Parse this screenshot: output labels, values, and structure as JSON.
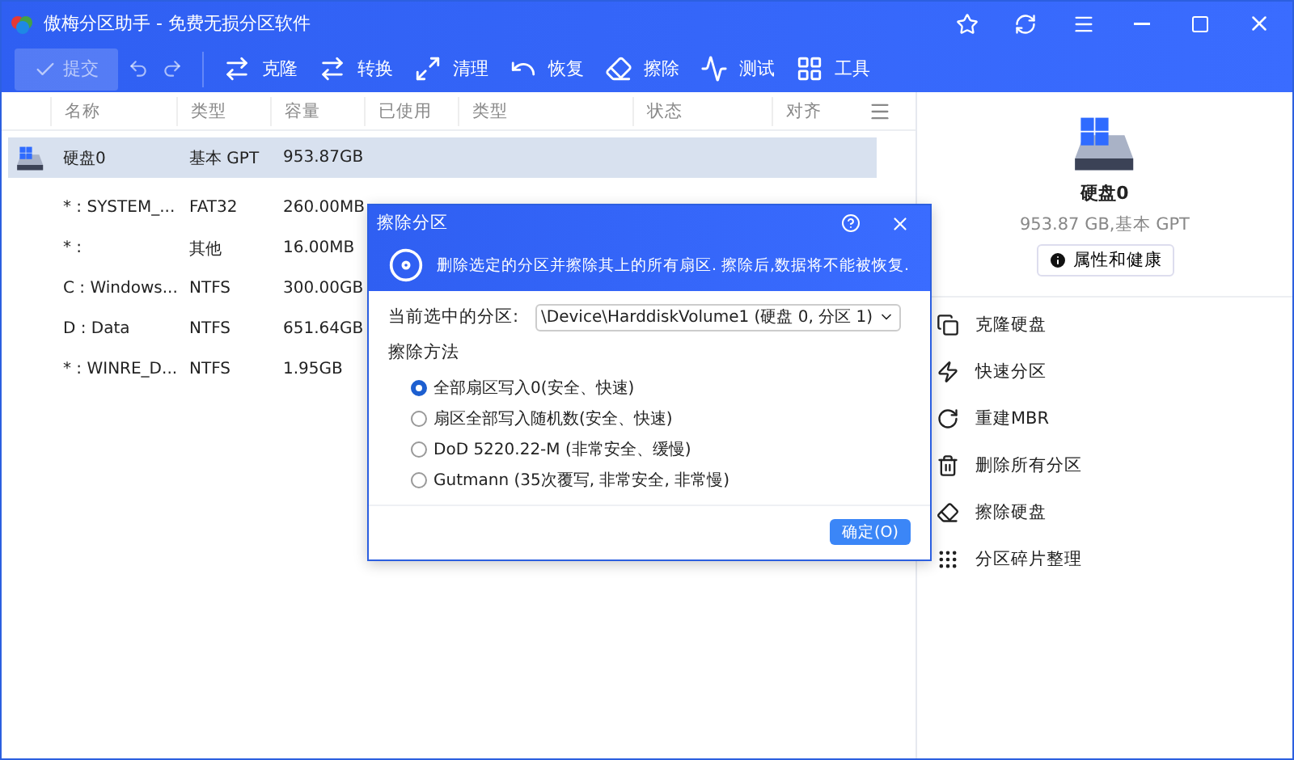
{
  "window": {
    "title": "傲梅分区助手 - 免费无损分区软件"
  },
  "toolbar": {
    "commit": {
      "label": "提交",
      "disabled": true
    },
    "tools": [
      {
        "kind": "clone",
        "label": "克隆"
      },
      {
        "kind": "convert",
        "label": "转换"
      },
      {
        "kind": "clean",
        "label": "清理"
      },
      {
        "kind": "recover",
        "label": "恢复"
      },
      {
        "kind": "wipe",
        "label": "擦除"
      },
      {
        "kind": "test",
        "label": "测试"
      },
      {
        "kind": "tools",
        "label": "工具"
      }
    ]
  },
  "table": {
    "columns": [
      "名称",
      "类型",
      "容量",
      "已使用",
      "类型",
      "状态",
      "对齐"
    ],
    "disks": [
      {
        "name": "硬盘0",
        "type": "基本 GPT",
        "capacity": "953.87GB",
        "selected": true,
        "children": [
          {
            "name": "* : SYSTEM_...",
            "fs": "FAT32",
            "capacity": "260.00MB",
            "selected": false
          },
          {
            "name": "* :",
            "fs": "其他",
            "capacity": "16.00MB",
            "selected": false
          },
          {
            "name": "C : Windows...",
            "fs": "NTFS",
            "capacity": "300.00GB",
            "selected": false
          },
          {
            "name": "D : Data",
            "fs": "NTFS",
            "capacity": "651.64GB",
            "selected": false
          },
          {
            "name": "* : WINRE_D...",
            "fs": "NTFS",
            "capacity": "1.95GB",
            "selected": false
          }
        ]
      }
    ]
  },
  "side_panel": {
    "disk_name": "硬盘0",
    "disk_summary": "953.87 GB,基本 GPT",
    "health_button": "属性和健康",
    "actions": [
      {
        "kind": "clone",
        "label": "克隆硬盘"
      },
      {
        "kind": "quick",
        "label": "快速分区"
      },
      {
        "kind": "mbr",
        "label": "重建MBR"
      },
      {
        "kind": "delete",
        "label": "删除所有分区"
      },
      {
        "kind": "erase",
        "label": "擦除硬盘"
      },
      {
        "kind": "defrag",
        "label": "分区碎片整理"
      }
    ]
  },
  "dialog": {
    "title": "擦除分区",
    "message": "删除选定的分区并擦除其上的所有扇区. 擦除后,数据将不能被恢复.",
    "partition_label": "当前选中的分区:",
    "partition_value": "\\Device\\HarddiskVolume1 (硬盘 0, 分区 1)",
    "method_label": "擦除方法",
    "methods": [
      {
        "label": "全部扇区写入0(安全、快速)",
        "selected": true
      },
      {
        "label": "扇区全部写入随机数(安全、快速)",
        "selected": false
      },
      {
        "label": "DoD 5220.22-M (非常安全、缓慢)",
        "selected": false
      },
      {
        "label": "Gutmann (35次覆写, 非常安全, 非常慢)",
        "selected": false
      }
    ],
    "ok_button": "确定(O)"
  }
}
